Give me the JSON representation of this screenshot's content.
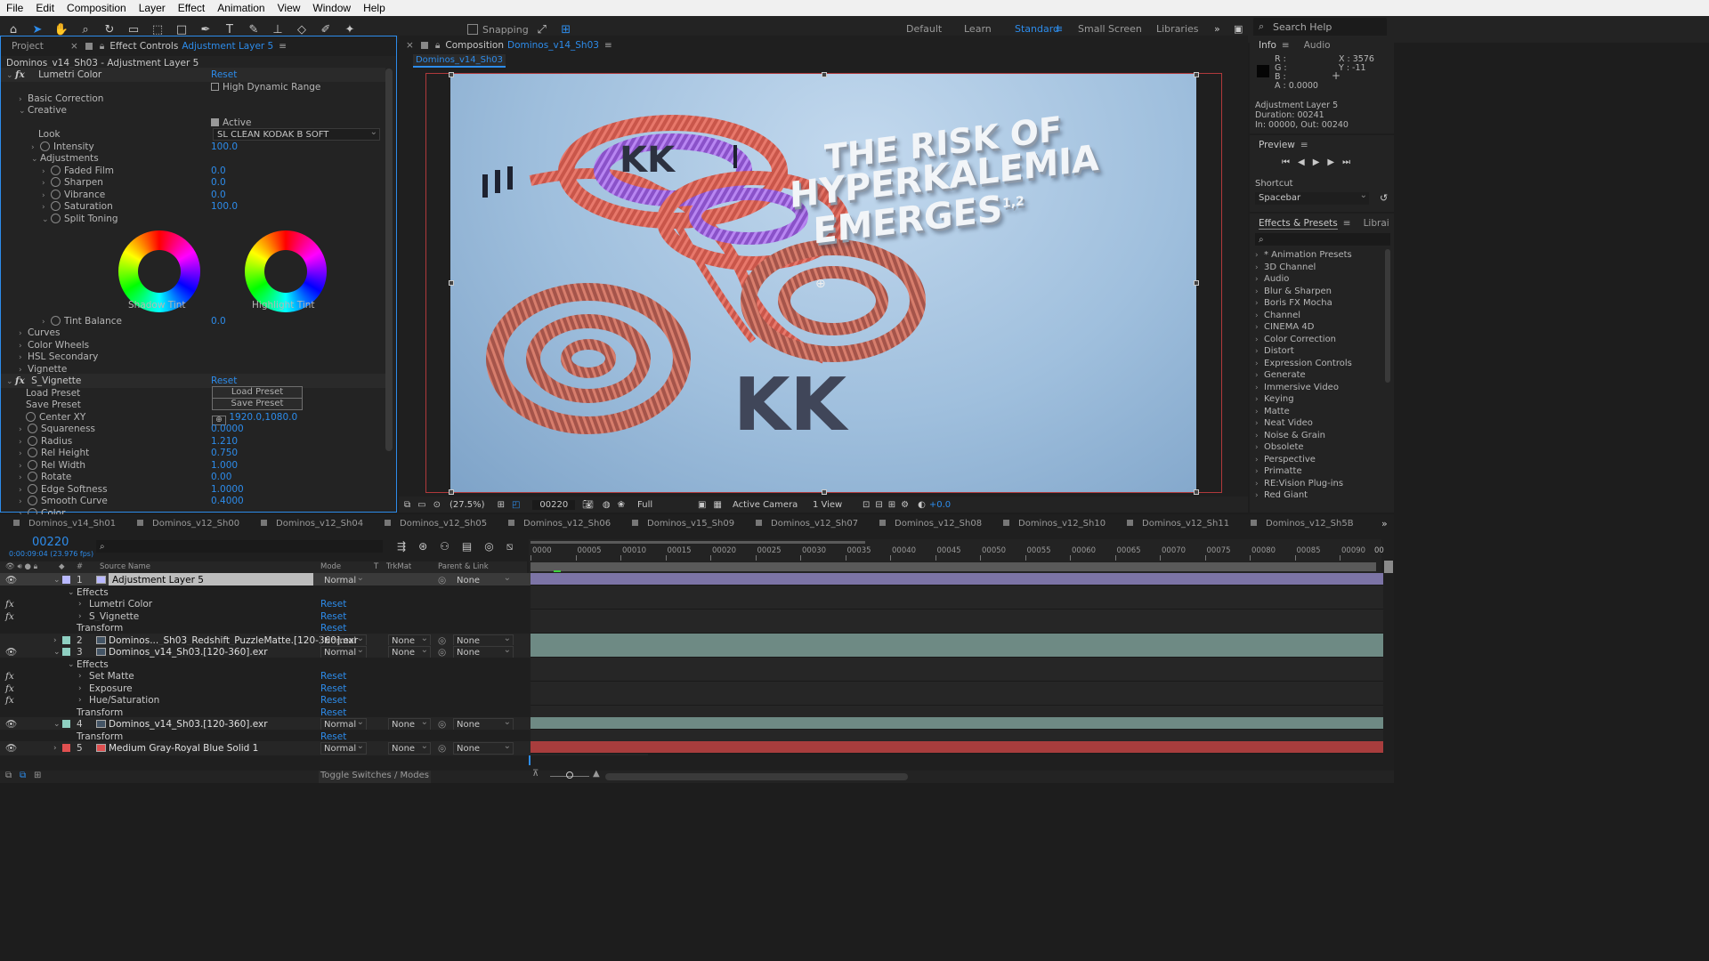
{
  "menu": [
    "File",
    "Edit",
    "Composition",
    "Layer",
    "Effect",
    "Animation",
    "View",
    "Window",
    "Help"
  ],
  "toolbar": {
    "snapping": "Snapping",
    "workspaces": [
      "Default",
      "Learn",
      "Standard",
      "Small Screen",
      "Libraries"
    ],
    "active_workspace": "Standard",
    "search": "Search Help"
  },
  "left_panel": {
    "tab_project": "Project",
    "tab_effect_controls": "Effect Controls",
    "tab_effect_target": "Adjustment Layer 5",
    "breadcrumb": "Dominos_v14_Sh03 - Adjustment Layer 5",
    "lumetri": "Lumetri Color",
    "reset": "Reset",
    "hdr": "High Dynamic Range",
    "basic": "Basic Correction",
    "creative": "Creative",
    "active": "Active",
    "look_label": "Look",
    "look_value": "SL CLEAN KODAK B SOFT",
    "intensity": "Intensity",
    "intensity_val": "100.0",
    "adjustments": "Adjustments",
    "faded": "Faded Film",
    "faded_val": "0.0",
    "sharpen": "Sharpen",
    "sharpen_val": "0.0",
    "vibrance": "Vibrance",
    "vibrance_val": "0.0",
    "saturation": "Saturation",
    "saturation_val": "100.0",
    "split": "Split Toning",
    "shadow_tint": "Shadow Tint",
    "highlight_tint": "Highlight Tint",
    "tint_balance": "Tint Balance",
    "tint_balance_val": "0.0",
    "curves": "Curves",
    "color_wheels": "Color Wheels",
    "hsl": "HSL Secondary",
    "vignette": "Vignette",
    "s_vignette": "S_Vignette",
    "load_preset": "Load Preset",
    "save_preset": "Save Preset",
    "center_xy": "Center XY",
    "center_val": "1920.0,1080.0",
    "params": [
      {
        "label": "Squareness",
        "value": "0.0000"
      },
      {
        "label": "Radius",
        "value": "1.210"
      },
      {
        "label": "Rel Height",
        "value": "0.750"
      },
      {
        "label": "Rel Width",
        "value": "1.000"
      },
      {
        "label": "Rotate",
        "value": "0.00"
      },
      {
        "label": "Edge Softness",
        "value": "1.0000"
      },
      {
        "label": "Smooth Curve",
        "value": "0.4000"
      },
      {
        "label": "Color",
        "value": ""
      }
    ]
  },
  "composition": {
    "tab_label": "Composition",
    "tab_name": "Dominos_v14_Sh03",
    "subtab": "Dominos_v14_Sh03",
    "title_lines": [
      "THE RISK OF",
      "HYPERKALEMIA",
      "EMERGES"
    ],
    "title_sup": "1,2",
    "zoom": "(27.5%)",
    "frame": "00220",
    "resolution": "Full",
    "camera": "Active Camera",
    "views": "1 View",
    "exposure": "+0.0"
  },
  "info": {
    "tab_info": "Info",
    "tab_audio": "Audio",
    "r": "R :",
    "g": "G :",
    "b": "B :",
    "a": "A : 0.0000",
    "x": "X : 3576",
    "y": "Y : -11",
    "layer": "Adjustment Layer 5",
    "duration": "Duration: 00241",
    "inout": "In: 00000, Out: 00240",
    "preview": "Preview",
    "shortcut_label": "Shortcut",
    "shortcut": "Spacebar"
  },
  "effects_presets": {
    "tab": "Effects & Presets",
    "tab2": "Librai",
    "items": [
      "* Animation Presets",
      "3D Channel",
      "Audio",
      "Blur & Sharpen",
      "Boris FX Mocha",
      "Channel",
      "CINEMA 4D",
      "Color Correction",
      "Distort",
      "Expression Controls",
      "Generate",
      "Immersive Video",
      "Keying",
      "Matte",
      "Neat Video",
      "Noise & Grain",
      "Obsolete",
      "Perspective",
      "Primatte",
      "RE:Vision Plug-ins",
      "Red Giant"
    ]
  },
  "timeline": {
    "tabs": [
      "Dominos_v14_Sh01",
      "Dominos_v12_Sh00",
      "Dominos_v12_Sh04",
      "Dominos_v12_Sh05",
      "Dominos_v12_Sh06",
      "Dominos_v15_Sh09",
      "Dominos_v12_Sh07",
      "Dominos_v12_Sh08",
      "Dominos_v12_Sh10",
      "Dominos_v12_Sh11",
      "Dominos_v12_Sh5B"
    ],
    "timecode": "00220",
    "timecode_sub": "0:00:09:04 (23.976 fps)",
    "col_source": "Source Name",
    "col_mode": "Mode",
    "col_t": "T",
    "col_trkmat": "TrkMat",
    "col_parent": "Parent & Link",
    "ruler": [
      "0000",
      "00005",
      "00010",
      "00015",
      "00020",
      "00025",
      "00030",
      "00035",
      "00040",
      "00045",
      "00050",
      "00055",
      "00060",
      "00065",
      "00070",
      "00075",
      "00080",
      "00085",
      "00090"
    ],
    "ruler_end": "00",
    "normal": "Normal",
    "none": "None",
    "effects_label": "Effects",
    "transform_label": "Transform",
    "reset": "Reset",
    "layers": [
      {
        "num": "1",
        "name": "Adjustment Layer 5"
      },
      {
        "num": "2",
        "name": "Dominos..._Sh03_Redshift_PuzzleMatte.[120-360].exr"
      },
      {
        "num": "3",
        "name": "Dominos_v14_Sh03.[120-360].exr"
      },
      {
        "num": "4",
        "name": "Dominos_v14_Sh03.[120-360].exr"
      },
      {
        "num": "5",
        "name": "Medium Gray-Royal Blue Solid 1"
      }
    ],
    "l1_effects": [
      "Lumetri Color",
      "S_Vignette"
    ],
    "l3_effects": [
      "Set Matte",
      "Exposure",
      "Hue/Saturation"
    ],
    "toggle": "Toggle Switches / Modes"
  },
  "colors": {
    "accent": "#2d8ceb",
    "adj_bar": "#7c74a6",
    "footage_bar": "#6e8a84",
    "solid_bar": "#a83d3d"
  }
}
